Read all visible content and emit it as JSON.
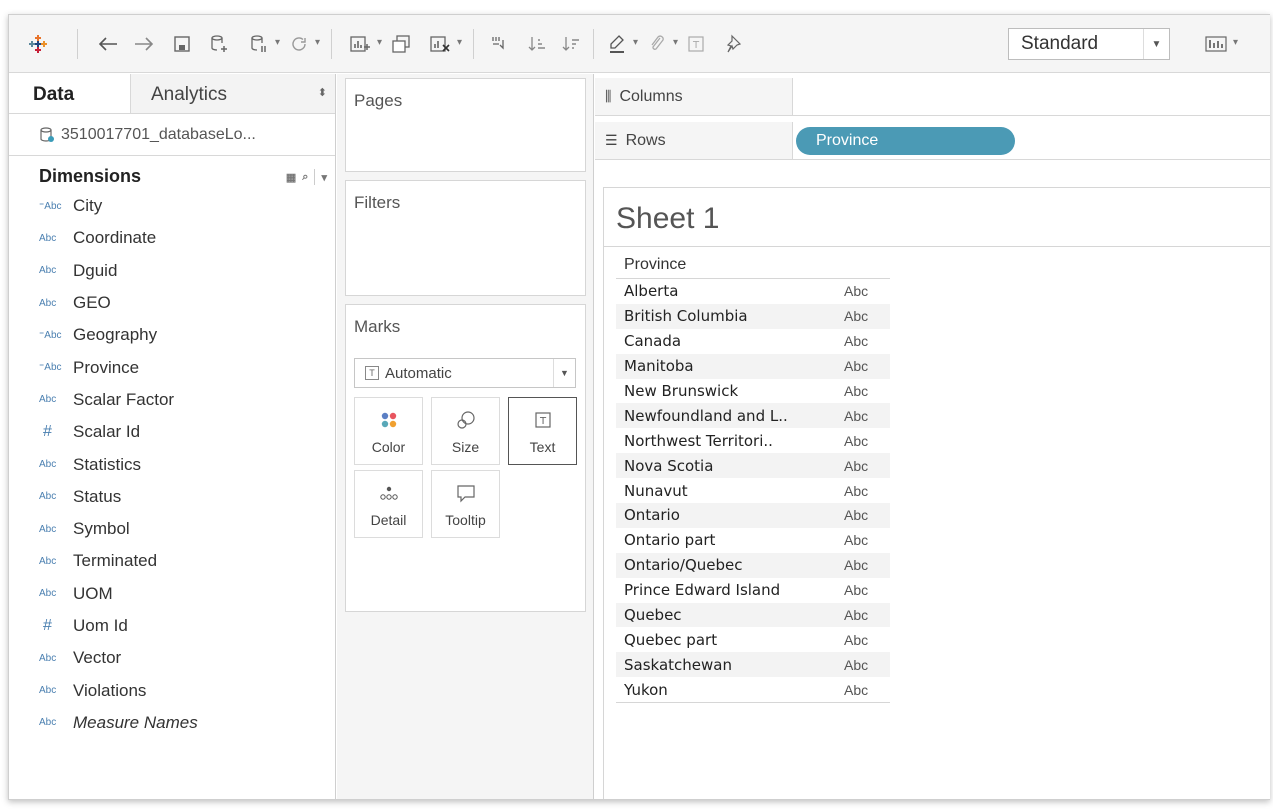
{
  "toolbar": {
    "icons": [
      "tableau-logo-icon",
      "back-icon",
      "forward-icon",
      "save-icon",
      "new-datasource-icon",
      "pause-updates-icon",
      "refresh-icon",
      "new-worksheet-icon",
      "duplicate-icon",
      "clear-icon",
      "swap-icon",
      "sort-asc-icon",
      "sort-desc-icon",
      "highlight-icon",
      "group-icon",
      "labels-icon",
      "pin-icon",
      "show-me-icon"
    ],
    "fit_value": "Standard"
  },
  "data_pane": {
    "tab_data": "Data",
    "tab_analytics": "Analytics",
    "datasource": "3510017701_databaseLo...",
    "dimensions_title": "Dimensions",
    "fields": [
      {
        "icon": "⁼Abc",
        "name": "City",
        "type": "geo"
      },
      {
        "icon": "Abc",
        "name": "Coordinate",
        "type": "string"
      },
      {
        "icon": "Abc",
        "name": "Dguid",
        "type": "string"
      },
      {
        "icon": "Abc",
        "name": "GEO",
        "type": "string"
      },
      {
        "icon": "⁼Abc",
        "name": "Geography",
        "type": "geo"
      },
      {
        "icon": "⁼Abc",
        "name": "Province",
        "type": "geo"
      },
      {
        "icon": "Abc",
        "name": "Scalar Factor",
        "type": "string"
      },
      {
        "icon": "#",
        "name": "Scalar Id",
        "type": "number"
      },
      {
        "icon": "Abc",
        "name": "Statistics",
        "type": "string"
      },
      {
        "icon": "Abc",
        "name": "Status",
        "type": "string"
      },
      {
        "icon": "Abc",
        "name": "Symbol",
        "type": "string"
      },
      {
        "icon": "Abc",
        "name": "Terminated",
        "type": "string"
      },
      {
        "icon": "Abc",
        "name": "UOM",
        "type": "string"
      },
      {
        "icon": "#",
        "name": "Uom Id",
        "type": "number"
      },
      {
        "icon": "Abc",
        "name": "Vector",
        "type": "string"
      },
      {
        "icon": "Abc",
        "name": "Violations",
        "type": "string"
      },
      {
        "icon": "Abc",
        "name": "Measure Names",
        "type": "string",
        "italic": true
      }
    ]
  },
  "shelves": {
    "pages": "Pages",
    "filters": "Filters",
    "marks": "Marks",
    "mark_type": "Automatic",
    "mark_buttons": [
      {
        "key": "color",
        "label": "Color"
      },
      {
        "key": "size",
        "label": "Size"
      },
      {
        "key": "text",
        "label": "Text"
      },
      {
        "key": "detail",
        "label": "Detail"
      },
      {
        "key": "tooltip",
        "label": "Tooltip"
      }
    ],
    "columns": "Columns",
    "rows": "Rows",
    "rows_pill": "Province"
  },
  "view": {
    "sheet_title": "Sheet 1",
    "column_header": "Province",
    "rows": [
      {
        "name": "Alberta",
        "value": "Abc"
      },
      {
        "name": "British Columbia",
        "value": "Abc"
      },
      {
        "name": "Canada",
        "value": "Abc"
      },
      {
        "name": "Manitoba",
        "value": "Abc"
      },
      {
        "name": "New Brunswick",
        "value": "Abc"
      },
      {
        "name": "Newfoundland and L..",
        "value": "Abc"
      },
      {
        "name": "Northwest Territori..",
        "value": "Abc"
      },
      {
        "name": "Nova Scotia",
        "value": "Abc"
      },
      {
        "name": "Nunavut",
        "value": "Abc"
      },
      {
        "name": "Ontario",
        "value": "Abc"
      },
      {
        "name": "Ontario part",
        "value": "Abc"
      },
      {
        "name": "Ontario/Quebec",
        "value": "Abc"
      },
      {
        "name": "Prince Edward Island",
        "value": "Abc"
      },
      {
        "name": "Quebec",
        "value": "Abc"
      },
      {
        "name": "Quebec part",
        "value": "Abc"
      },
      {
        "name": "Saskatchewan",
        "value": "Abc"
      },
      {
        "name": "Yukon",
        "value": "Abc"
      }
    ]
  },
  "colors": {
    "pill": "#4b9ab5",
    "field_icon": "#4a7fb0",
    "row_alt": "#f3f3f3"
  }
}
